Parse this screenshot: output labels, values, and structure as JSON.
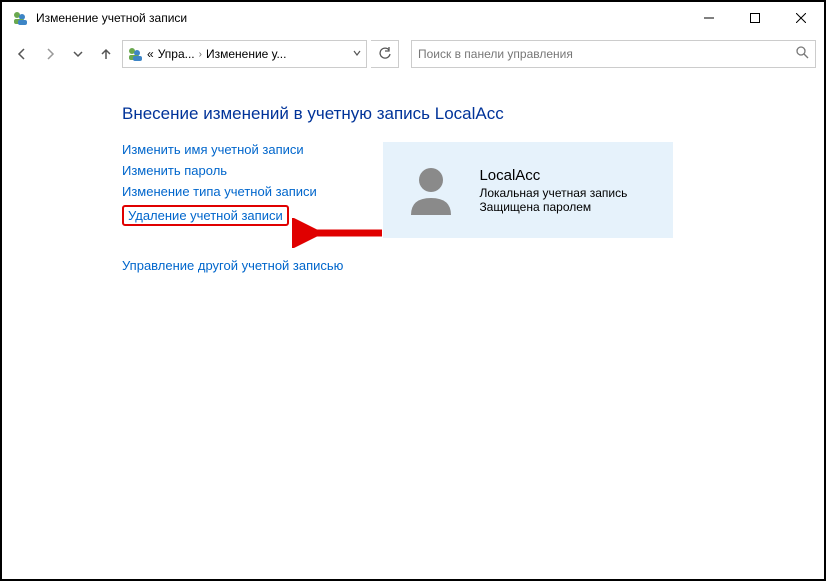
{
  "window": {
    "title": "Изменение учетной записи"
  },
  "breadcrumb": {
    "part1": "Упра...",
    "part2": "Изменение у..."
  },
  "search": {
    "placeholder": "Поиск в панели управления"
  },
  "heading": "Внесение изменений в учетную запись LocalAcc",
  "links": {
    "rename": "Изменить имя учетной записи",
    "password": "Изменить пароль",
    "type": "Изменение типа учетной записи",
    "delete": "Удаление учетной записи",
    "other": "Управление другой учетной записью"
  },
  "account": {
    "name": "LocalAcc",
    "type": "Локальная учетная запись",
    "protection": "Защищена паролем"
  }
}
